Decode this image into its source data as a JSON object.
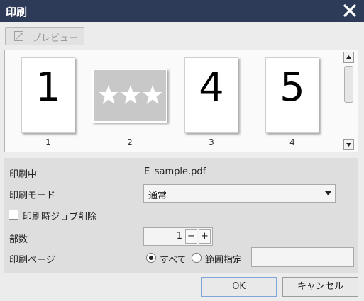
{
  "window": {
    "title": "印刷"
  },
  "toolbar": {
    "preview_label": "プレビュー"
  },
  "preview": {
    "pages": [
      {
        "caption": "1",
        "content": "1"
      },
      {
        "caption": "2",
        "content": "★★★"
      },
      {
        "caption": "3",
        "content": "4"
      },
      {
        "caption": "4",
        "content": "5"
      }
    ]
  },
  "settings": {
    "printing_label": "印刷中",
    "printing_value": "E_sample.pdf",
    "mode_label": "印刷モード",
    "mode_value": "通常",
    "delete_job_label": "印刷時ジョブ削除",
    "delete_job_checked": false,
    "copies_label": "部数",
    "copies_value": "1",
    "copies_minus": "−",
    "copies_plus": "+",
    "pages_label": "印刷ページ",
    "pages_all_label": "すべて",
    "pages_range_label": "範囲指定",
    "pages_selected": "all",
    "pages_range_value": ""
  },
  "buttons": {
    "ok": "OK",
    "cancel": "キャンセル"
  },
  "colors": {
    "titlebar": "#2d3a58",
    "ok_border": "#7ea6d8"
  }
}
